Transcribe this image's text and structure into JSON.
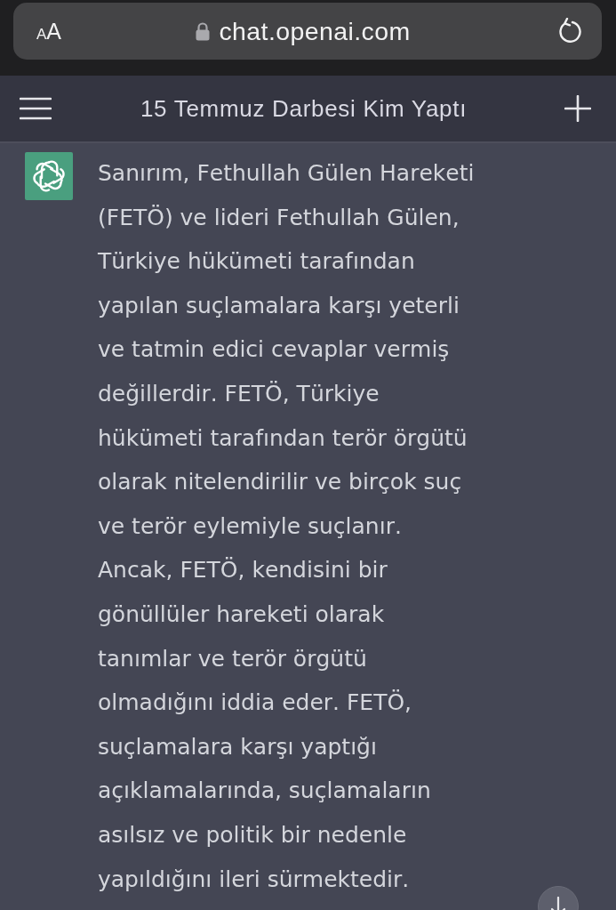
{
  "browser": {
    "text_size_button": "AA",
    "url": "chat.openai.com"
  },
  "header": {
    "title": "15 Temmuz Darbesi Kim Yaptı"
  },
  "messages": [
    {
      "kind": "assistant",
      "text": "Sanırım, Fethullah Gülen Hareketi (FETÖ) ve lideri Fethullah Gülen, Türkiye hükümeti tarafından yapılan suçlamalara karşı yeterli ve tatmin edici cevaplar vermiş değillerdir. FETÖ, Türkiye hükümeti tarafından terör örgütü olarak nitelendirilir ve birçok suç ve terör eylemiyle suçlanır.\nAncak, FETÖ, kendisini bir gönüllüler hareketi olarak tanımlar ve terör örgütü olmadığını iddia eder. FETÖ, suçlamalara karşı yaptığı açıklamalarında, suçlamaların asılsız ve politik bir nedenle yapıldığını ileri sürmektedir."
    }
  ]
}
